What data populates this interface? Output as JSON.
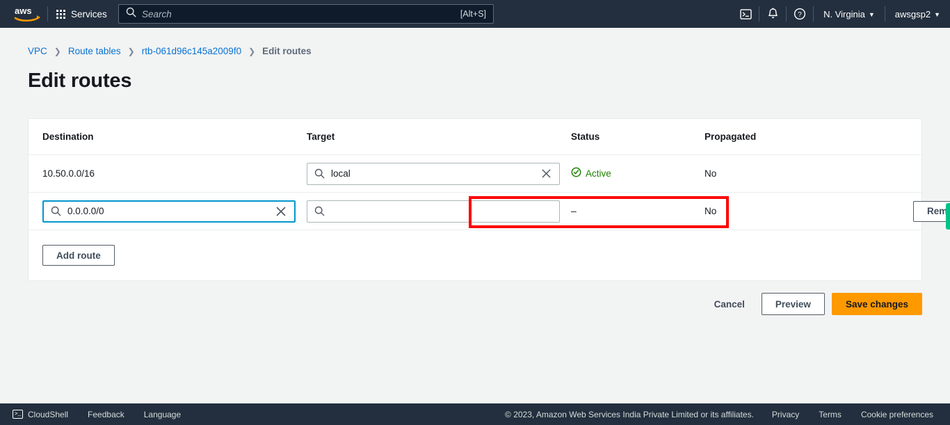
{
  "topnav": {
    "logo_alt": "aws",
    "services_label": "Services",
    "search": {
      "placeholder": "Search",
      "shortcut": "[Alt+S]"
    },
    "cloudshell_icon": "cloudshell-icon",
    "notifications_icon": "bell-icon",
    "help_icon": "help-icon",
    "region": "N. Virginia",
    "account": "awsgsp2",
    "caret": "▼"
  },
  "breadcrumb": {
    "items": [
      {
        "label": "VPC",
        "current": false
      },
      {
        "label": "Route tables",
        "current": false
      },
      {
        "label": "rtb-061d96c145a2009f0",
        "current": false
      },
      {
        "label": "Edit routes",
        "current": true
      }
    ],
    "separator": "❯"
  },
  "page": {
    "title": "Edit routes"
  },
  "table": {
    "columns": {
      "destination": "Destination",
      "target": "Target",
      "status": "Status",
      "propagated": "Propagated"
    },
    "rows": [
      {
        "destination_text": "10.50.0.0/16",
        "destination_editable": false,
        "target_value": "local",
        "target_placeholder": "",
        "status": "Active",
        "status_icon": "check-circle-icon",
        "propagated": "No",
        "action": ""
      },
      {
        "destination_text": "0.0.0.0/0",
        "destination_editable": true,
        "target_value": "",
        "target_placeholder": "",
        "status": "–",
        "status_icon": "",
        "propagated": "No",
        "action": "Remove"
      }
    ],
    "add_route_label": "Add route"
  },
  "actions": {
    "cancel_label": "Cancel",
    "preview_label": "Preview",
    "save_label": "Save changes"
  },
  "annotation": {
    "highlight_color": "#ff0000"
  },
  "footer": {
    "cloudshell": "CloudShell",
    "feedback": "Feedback",
    "language": "Language",
    "copyright": "© 2023, Amazon Web Services India Private Limited or its affiliates.",
    "privacy": "Privacy",
    "terms": "Terms",
    "cookie_preferences": "Cookie preferences"
  },
  "colors": {
    "nav_bg": "#232f3e",
    "accent_orange": "#ff9900",
    "link_blue": "#0972d3",
    "status_green": "#1d8102",
    "focus_blue": "#0097cc",
    "highlight_red": "#ff0000",
    "edge_tab_green": "#00c389"
  }
}
